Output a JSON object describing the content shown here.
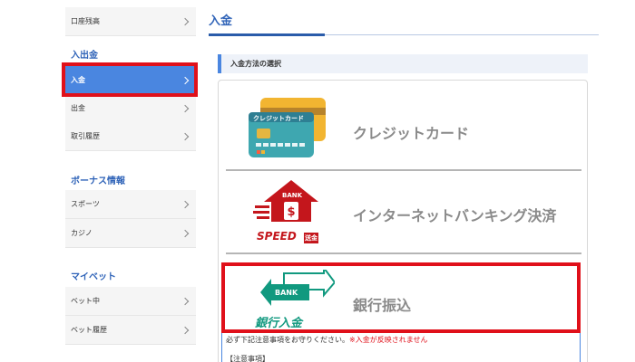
{
  "sidebar": {
    "top_item": {
      "label": "口座残高"
    },
    "sections": [
      {
        "heading": "入出金",
        "items": [
          {
            "label": "入金",
            "active": true
          },
          {
            "label": "出金"
          },
          {
            "label": "取引履歴"
          }
        ]
      },
      {
        "heading": "ボーナス情報",
        "items": [
          {
            "label": "スポーツ"
          },
          {
            "label": "カジノ"
          }
        ]
      },
      {
        "heading": "マイベット",
        "items": [
          {
            "label": "ベット中"
          },
          {
            "label": "ベット履歴"
          }
        ]
      }
    ]
  },
  "main": {
    "page_title": "入金",
    "section_title": "入金方法の選択",
    "methods": [
      {
        "label": "クレジットカード",
        "icon": "credit-card-icon",
        "icon_text": "クレジットカード"
      },
      {
        "label": "インターネットバンキング決済",
        "icon": "bank-speed-icon",
        "icon_text": "BANK",
        "icon_sub": "SPEED",
        "icon_sub2": "送金"
      },
      {
        "label": "銀行振込",
        "icon": "bank-transfer-icon",
        "icon_text": "BANK",
        "icon_sub": "銀行入金"
      }
    ],
    "notice": {
      "line1": "必ず下記注意事項をお守りください。",
      "line1_warn": "※入金が反映されません",
      "line2": "【注意事項】"
    }
  },
  "colors": {
    "accent": "#2f63b8",
    "active_bg": "#4a86e0",
    "highlight": "#e0101a",
    "bank_red": "#c4161c",
    "bank_green": "#11997f"
  }
}
